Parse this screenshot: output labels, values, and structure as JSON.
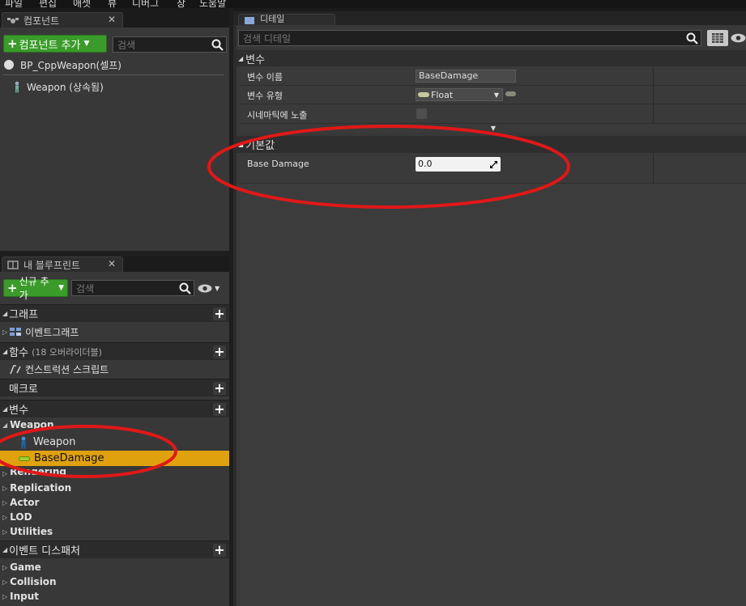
{
  "menu": [
    "파일",
    "편집",
    "애셋",
    "뷰",
    "디버그",
    "창",
    "도움말"
  ],
  "components_panel": {
    "tab_label": "컴포넌트",
    "add_button": "컴포넌트 추가",
    "search_placeholder": "검색",
    "items": [
      "BP_CppWeapon(셀프)",
      "Weapon (상속됨)"
    ]
  },
  "blueprint_panel": {
    "tab_label": "내 블루프린트",
    "add_button": "신규 추가",
    "search_placeholder": "검색",
    "sections": {
      "graph": "그래프",
      "event_graph": "이벤트그래프",
      "functions": "함수",
      "functions_note": "(18 오버라이더블)",
      "construction_script": "컨스트럭션 스크립트",
      "macros": "매크로",
      "variables": "변수",
      "weapon_category": "Weapon",
      "var_weapon": "Weapon",
      "var_basedamage": "BaseDamage",
      "rendering": "Rendering",
      "replication": "Replication",
      "actor": "Actor",
      "lod": "LOD",
      "utilities": "Utilities",
      "event_dispatchers": "이벤트 디스패처",
      "game": "Game",
      "collision": "Collision",
      "input": "Input"
    }
  },
  "details_panel": {
    "tab_label": "디테일",
    "search_placeholder": "검색 디테일",
    "variable_section": "변수",
    "var_name_label": "변수 이름",
    "var_name_value": "BaseDamage",
    "var_type_label": "변수 유형",
    "var_type_value": "Float",
    "cinematic_label": "시네마틱에 노출",
    "default_section": "기본값",
    "base_damage_label": "Base Damage",
    "base_damage_value": "0.0"
  },
  "colors": {
    "accent_green": "#3a9b2a",
    "selected_row": "#e0a10e",
    "annotation_red": "#e01818"
  }
}
